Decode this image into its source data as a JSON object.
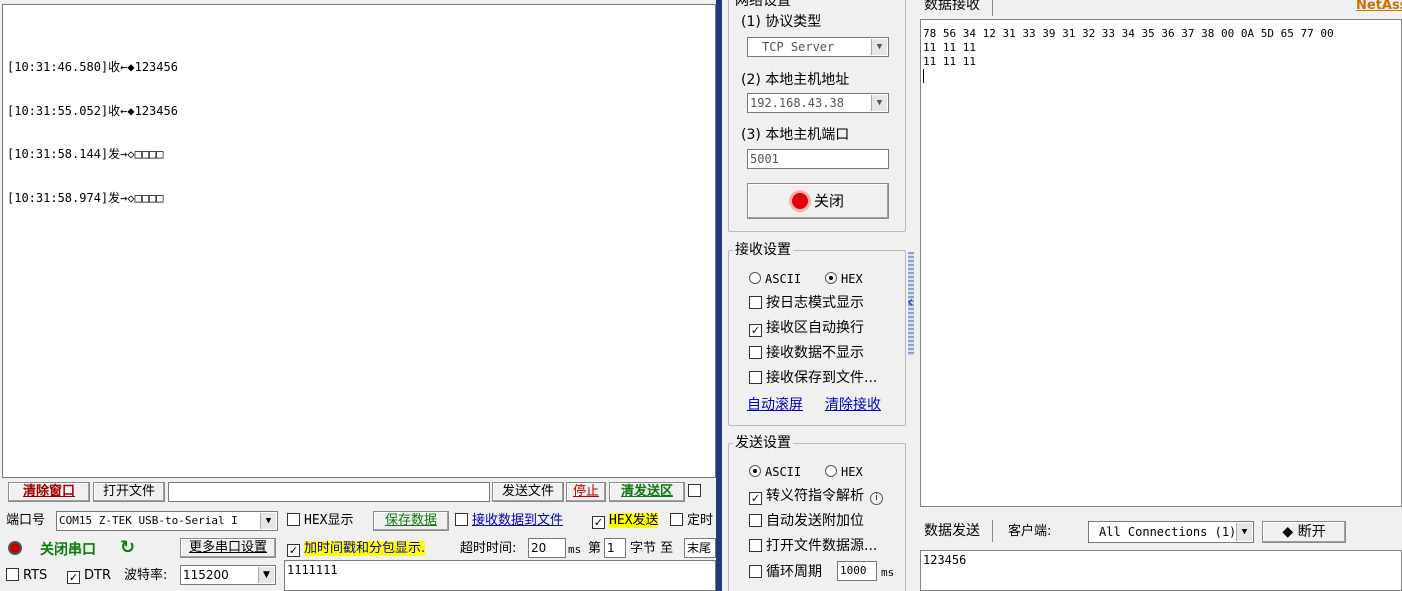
{
  "serial": {
    "log_lines": [
      "[10:31:46.580]收←◆123456",
      "[10:31:55.052]收←◆123456",
      "[10:31:58.144]发→◇□□□□",
      "[10:31:58.974]发→◇□□□□"
    ],
    "toolbar": {
      "clear_window": "清除窗口",
      "open_file": "打开文件",
      "send_file": "发送文件",
      "stop": "停止",
      "clear_send": "清发送区"
    },
    "port": {
      "label": "端口号",
      "value": "COM15 Z-TEK USB-to-Serial I"
    },
    "options": {
      "hex_display": "HEX显示",
      "save_data": "保存数据",
      "recv_to_file": "接收数据到文件",
      "hex_send": "HEX发送",
      "timed": "定时",
      "timestamp": "加时间戳和分包显示.",
      "timeout_label": "超时时间:",
      "timeout_value": "20",
      "ms": "ms",
      "di": "第",
      "byte_value": "1",
      "byte_label": "字节 至",
      "end": "末尾"
    },
    "close_port": "关闭串口",
    "more_settings": "更多串口设置",
    "rts": "RTS",
    "dtr": "DTR",
    "baud_label": "波特率:",
    "baud_value": "115200",
    "send_text": "1111111"
  },
  "net": {
    "net_settings_title": "网络设置",
    "protocol_label": "(1) 协议类型",
    "protocol_value": "TCP Server",
    "host_label": "(2) 本地主机地址",
    "host_value": "192.168.43.38",
    "port_label": "(3) 本地主机端口",
    "port_value": "5001",
    "close_btn": "关闭",
    "recv_settings_title": "接收设置",
    "ascii": "ASCII",
    "hex": "HEX",
    "log_mode": "按日志模式显示",
    "auto_wrap": "接收区自动换行",
    "no_display": "接收数据不显示",
    "save_to_file": "接收保存到文件...",
    "auto_scroll": "自动滚屏",
    "clear_recv": "清除接收",
    "send_settings_title": "发送设置",
    "escape": "转义符指令解析",
    "auto_append": "自动发送附加位",
    "open_file_source": "打开文件数据源...",
    "cycle": "循环周期",
    "cycle_value": "1000",
    "cycle_unit": "ms",
    "recv_tab": "数据接收",
    "brand": "NetAss",
    "recv_lines": [
      "78 56 34 12 31 33 39 31 32 33 34 35 36 37 38 00 0A 5D 65 77 00",
      "11 11 11",
      "11 11 11"
    ],
    "send_tab": "数据发送",
    "client_label": "客户端:",
    "connections": "All Connections (1)",
    "disconnect": "断开",
    "send_text": "123456"
  },
  "colors": {
    "divider": "#1e3a78",
    "brand": "#d07000"
  }
}
